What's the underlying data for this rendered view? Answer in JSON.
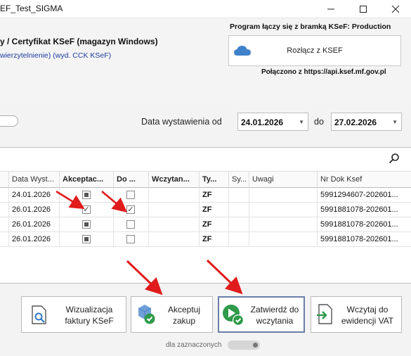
{
  "window": {
    "title": "EF_Test_SIGMA"
  },
  "cert": {
    "title": "y / Certyfikat KSeF (magazyn Windows)",
    "subtitle": "wierzytelnienie) (wyd. CCK KSeF)"
  },
  "ksef": {
    "program_label": "Program łączy się z bramką KSeF: Production",
    "disconnect_label": "Rozłącz z KSEF",
    "connected_label": "Połączono z https://api.ksef.mf.gov.pl"
  },
  "filter": {
    "date_from_label": "Data wystawienia od",
    "date_from": "24.01.2026",
    "to_label": "do",
    "date_to": "27.02.2026"
  },
  "table": {
    "headers": [
      "Data Wyst...",
      "Akceptac...",
      "Do ...",
      "Wczytan...",
      "Ty...",
      "Sy...",
      "Uwagi",
      "Nr Dok Ksef"
    ],
    "rows": [
      {
        "date": "24.01.2026",
        "akcept": "indeterminate",
        "do": "unchecked",
        "type": "ZF",
        "nr": "5991294607-202601..."
      },
      {
        "date": "26.01.2026",
        "akcept": "checked",
        "do": "checked",
        "type": "ZF",
        "nr": "5991881078-202601..."
      },
      {
        "date": "26.01.2026",
        "akcept": "indeterminate",
        "do": "unchecked",
        "type": "ZF",
        "nr": "5991881078-202601..."
      },
      {
        "date": "26.01.2026",
        "akcept": "indeterminate",
        "do": "unchecked",
        "type": "ZF",
        "nr": "5991881078-202601..."
      }
    ]
  },
  "actions": {
    "wizualizacja": {
      "line1": "Wizualizacja",
      "line2": "faktury KSeF"
    },
    "akceptuj": {
      "line1": "Akceptuj",
      "line2": "zakup"
    },
    "zatwierdz": {
      "line1": "Zatwierdź do",
      "line2": "wczytania"
    },
    "wczytaj": {
      "line1": "Wczytaj do",
      "line2": "ewidencji VAT"
    }
  },
  "footer": {
    "selected_label": "dla zaznaczonych"
  },
  "colors": {
    "arrow": "#e01b1b",
    "link_blue": "#1a3aa0",
    "accent_green": "#2e9a4a",
    "cloud_blue": "#3f82c9"
  }
}
